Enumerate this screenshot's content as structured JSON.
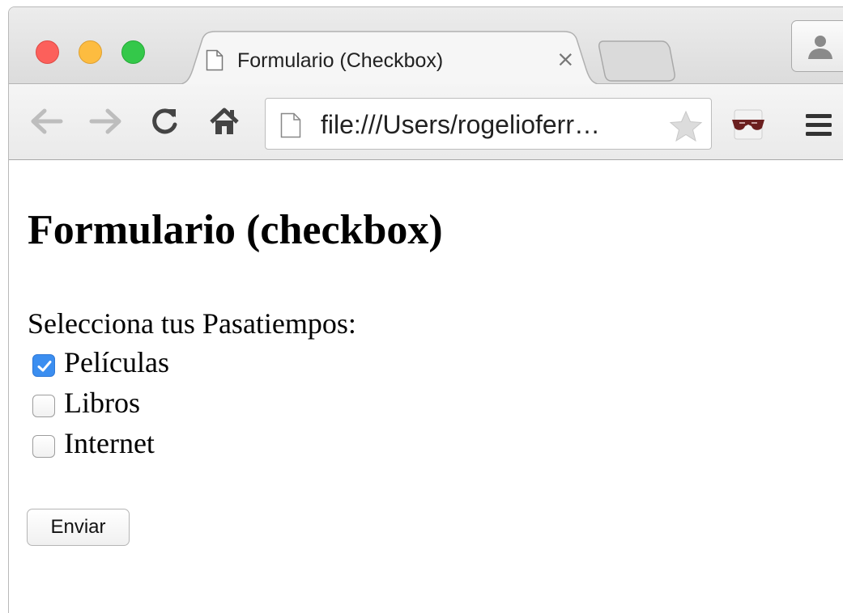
{
  "browser": {
    "tab": {
      "title": "Formulario (Checkbox)",
      "close_glyph": "×"
    },
    "address_bar": {
      "url": "file:///Users/rogelioferr…"
    },
    "icons": [
      "page-icon",
      "close-icon",
      "new-tab-icon",
      "profile-icon",
      "back-arrow-icon",
      "forward-arrow-icon",
      "reload-icon",
      "home-icon",
      "bookmark-star-icon",
      "incognito-extension-icon",
      "menu-icon"
    ]
  },
  "page": {
    "heading": "Formulario (checkbox)",
    "prompt": "Selecciona tus Pasatiempos:",
    "options": [
      {
        "label": "Películas",
        "checked": true
      },
      {
        "label": "Libros",
        "checked": false
      },
      {
        "label": "Internet",
        "checked": false
      }
    ],
    "submit_label": "Enviar"
  },
  "colors": {
    "close": "#fc605b",
    "minimize": "#fdbc40",
    "zoom": "#34c84a",
    "checkbox_checked": "#3b8ef0"
  }
}
